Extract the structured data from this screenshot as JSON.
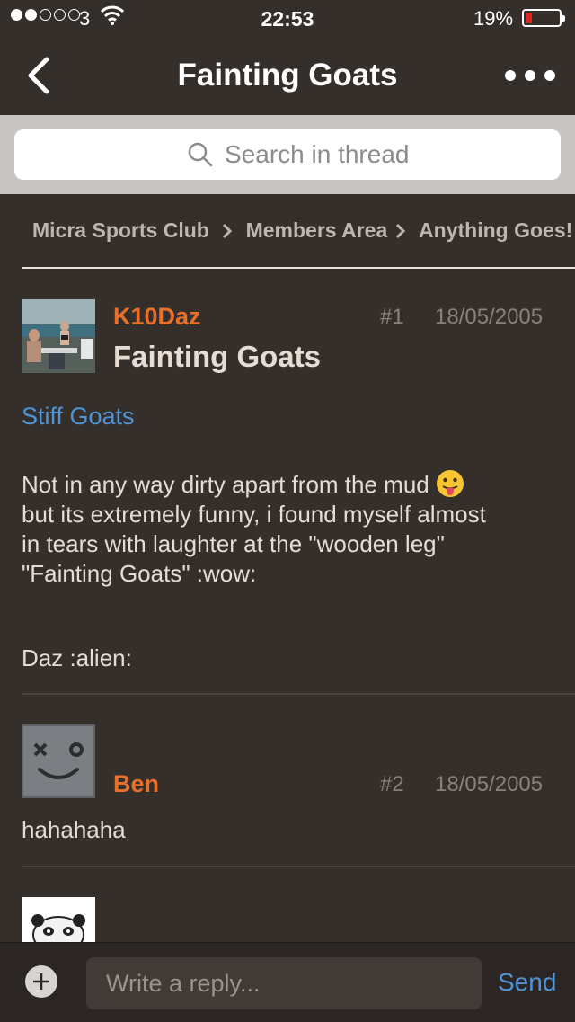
{
  "status_bar": {
    "carrier": "3",
    "time": "22:53",
    "battery_percent": "19%",
    "battery_level": 0.19,
    "signal_bars": 2
  },
  "nav": {
    "title": "Fainting Goats",
    "back_icon": "chevron-left-icon",
    "more_icon": "more-icon"
  },
  "search": {
    "placeholder": "Search in thread"
  },
  "breadcrumb": [
    "Micra Sports Club",
    "Members Area",
    "Anything Goes!"
  ],
  "posts": [
    {
      "author": "K10Daz",
      "number": "#1",
      "date": "18/05/2005",
      "title": "Fainting Goats",
      "link": "Stiff Goats",
      "body_line1": "Not in any way dirty apart from the mud ",
      "body_line2": "but its extremely funny, i found myself almost",
      "body_line3": "in tears with laughter at the \"wooden leg\"",
      "body_line4": "\"Fainting Goats\" :wow:",
      "signoff": "Daz :alien:"
    },
    {
      "author": "Ben",
      "number": "#2",
      "date": "18/05/2005",
      "body": "hahahaha"
    }
  ],
  "reply": {
    "placeholder": "Write a reply...",
    "send_label": "Send"
  },
  "colors": {
    "background": "#352f2c",
    "author": "#e8702a",
    "link": "#4f94d7",
    "battery_low": "#e2261f"
  }
}
